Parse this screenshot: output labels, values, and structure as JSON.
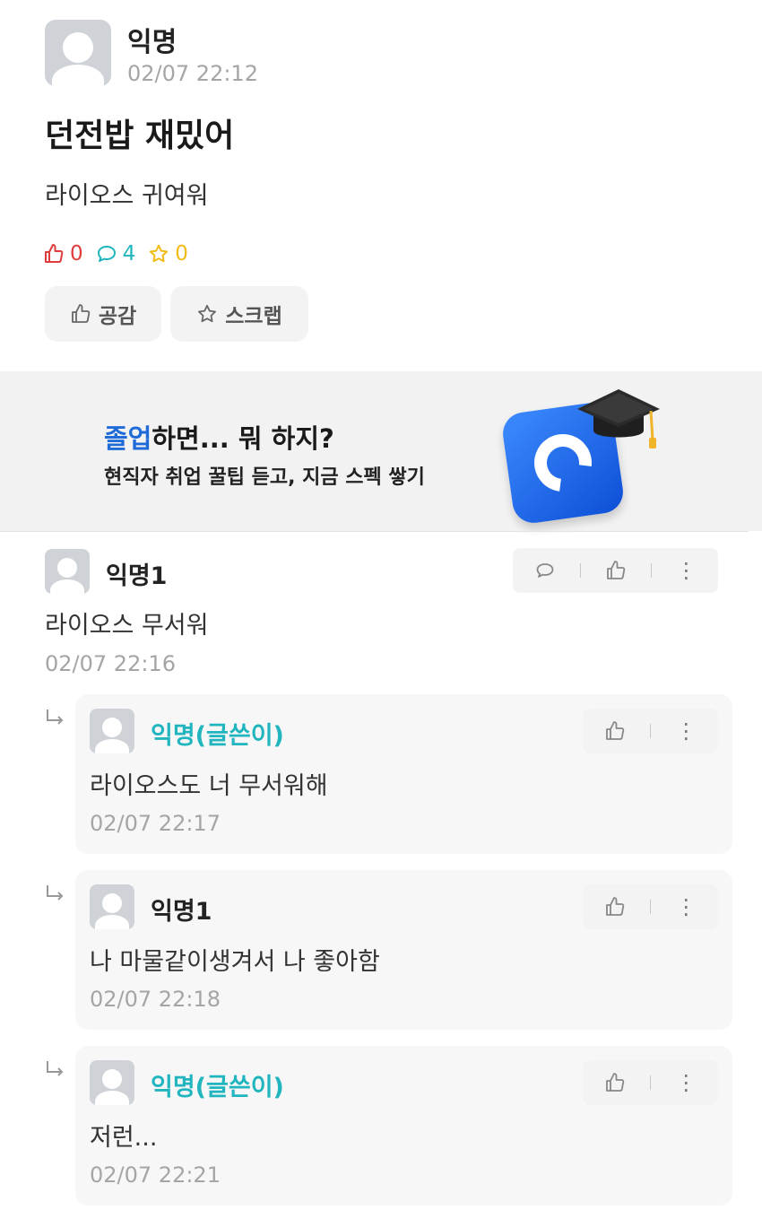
{
  "post": {
    "author": "익명",
    "time": "02/07 22:12",
    "title": "던전밥 재밌어",
    "body": "라이오스 귀여워",
    "likes": "0",
    "comments": "4",
    "scraps": "0",
    "like_button": "공감",
    "scrap_button": "스크랩"
  },
  "banner": {
    "title_highlight": "졸업",
    "title_rest": "하면... 뭐 하지?",
    "subtitle": "현직자 취업 꿀팁 듣고, 지금 스펙 쌓기"
  },
  "comments": [
    {
      "author": "익명1",
      "text": "라이오스 무서워",
      "time": "02/07 22:16"
    }
  ],
  "replies": [
    {
      "author": "익명(글쓴이)",
      "text": "라이오스도 너 무서워해",
      "time": "02/07 22:17"
    },
    {
      "author": "익명1",
      "text": "나 마물같이생겨서 나 좋아함",
      "time": "02/07 22:18"
    },
    {
      "author": "익명(글쓴이)",
      "text": "저런...",
      "time": "02/07 22:21"
    }
  ],
  "colors": {
    "like": "#e03c3c",
    "comment": "#21b5bf",
    "scrap": "#f2bb15",
    "author_highlight": "#21b5bf",
    "banner_highlight": "#1f6bd8"
  }
}
